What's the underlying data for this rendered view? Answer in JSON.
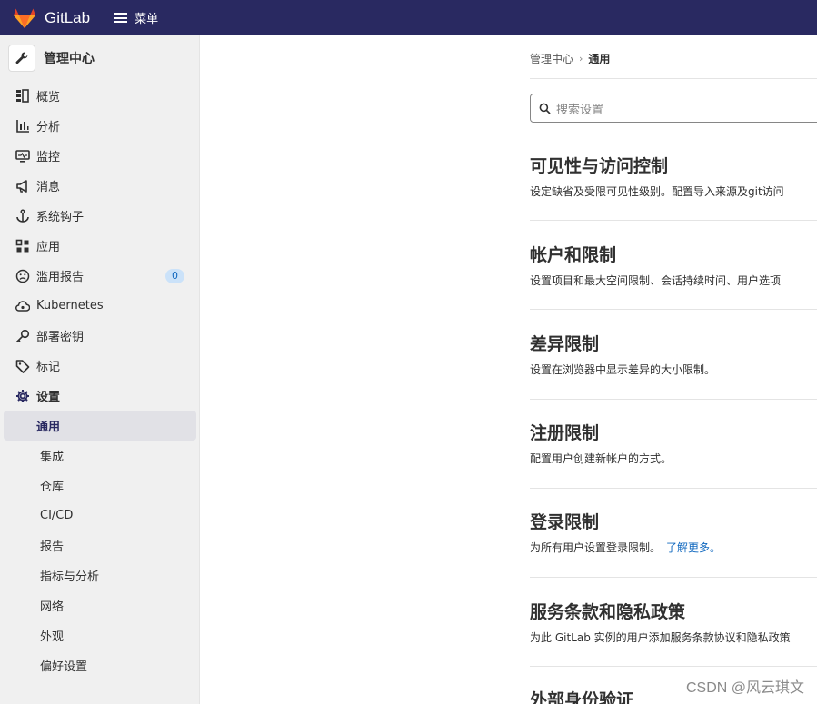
{
  "topbar": {
    "brand": "GitLab",
    "menu_label": "菜单",
    "bg_color": "#292961"
  },
  "sidebar": {
    "title": "管理中心",
    "items": [
      {
        "label": "概览",
        "icon": "overview-icon"
      },
      {
        "label": "分析",
        "icon": "chart-icon"
      },
      {
        "label": "监控",
        "icon": "monitor-icon"
      },
      {
        "label": "消息",
        "icon": "megaphone-icon"
      },
      {
        "label": "系统钩子",
        "icon": "anchor-icon"
      },
      {
        "label": "应用",
        "icon": "apps-icon"
      },
      {
        "label": "滥用报告",
        "icon": "face-sad-icon",
        "badge": "0"
      },
      {
        "label": "Kubernetes",
        "icon": "cloud-gear-icon"
      },
      {
        "label": "部署密钥",
        "icon": "key-icon"
      },
      {
        "label": "标记",
        "icon": "label-icon"
      },
      {
        "label": "设置",
        "icon": "settings-icon"
      }
    ],
    "settings_sub": [
      "通用",
      "集成",
      "仓库",
      "CI/CD",
      "报告",
      "指标与分析",
      "网络",
      "外观",
      "偏好设置"
    ]
  },
  "breadcrumb": {
    "parent": "管理中心",
    "current": "通用"
  },
  "search": {
    "placeholder": "搜索设置"
  },
  "sections": [
    {
      "title": "可见性与访问控制",
      "desc": "设定缺省及受限可见性级别。配置导入来源及git访问"
    },
    {
      "title": "帐户和限制",
      "desc": "设置项目和最大空间限制、会话持续时间、用户选项"
    },
    {
      "title": "差异限制",
      "desc": "设置在浏览器中显示差异的大小限制。"
    },
    {
      "title": "注册限制",
      "desc": "配置用户创建新帐户的方式。"
    },
    {
      "title": "登录限制",
      "desc": "为所有用户设置登录限制。",
      "link": "了解更多。"
    },
    {
      "title": "服务条款和隐私政策",
      "desc": "为此 GitLab 实例的用户添加服务条款协议和隐私政策"
    },
    {
      "title": "外部身份验证"
    }
  ],
  "watermark": "CSDN @风云琪文"
}
